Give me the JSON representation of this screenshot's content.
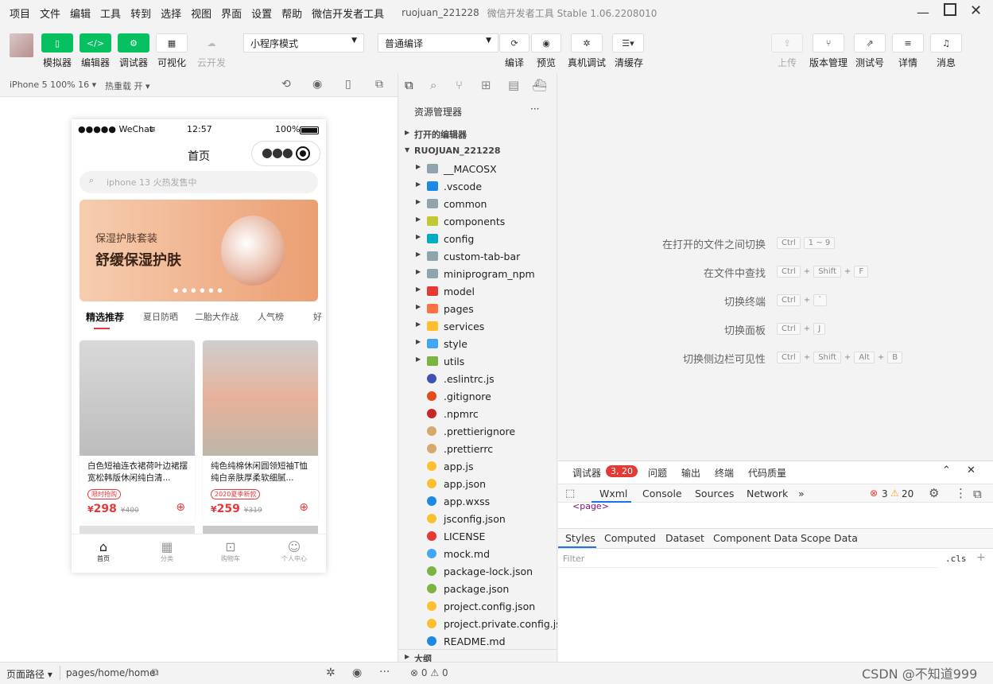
{
  "menubar": {
    "items": [
      "项目",
      "文件",
      "编辑",
      "工具",
      "转到",
      "选择",
      "视图",
      "界面",
      "设置",
      "帮助",
      "微信开发者工具"
    ],
    "project_name": "ruojuan_221228",
    "app_title": "微信开发者工具 Stable 1.06.2208010"
  },
  "toolbar": {
    "simulator": "模拟器",
    "editor": "编辑器",
    "debugger": "调试器",
    "visual": "可视化",
    "cloud": "云开发",
    "mode_select": "小程序模式",
    "compile_select": "普通编译",
    "compile": "编译",
    "preview": "预览",
    "remote_debug": "真机调试",
    "clear_cache": "清缓存",
    "upload": "上传",
    "version": "版本管理",
    "test_id": "测试号",
    "details": "详情",
    "messages": "消息"
  },
  "simbar": {
    "device": "iPhone 5 100% 16",
    "hot_reload": "热重载 开"
  },
  "phone": {
    "status_left": "●●●●● WeChat",
    "time": "12:57",
    "battery": "100%",
    "nav_title": "首页",
    "search_placeholder": "iphone 13 火热发售中",
    "banner_sub": "保湿护肤套装",
    "banner_title": "舒缓保湿护肤",
    "tabs": [
      "精选推荐",
      "夏日防晒",
      "二胎大作战",
      "人气榜",
      "好"
    ],
    "products": [
      {
        "title": "白色短袖连衣裙荷叶边裙摆宽松韩版休闲纯白清...",
        "tag": "限时抢购",
        "price": "298",
        "old": "400",
        "color": "#c9c9c9"
      },
      {
        "title": "纯色纯棉休闲圆领短袖T恤纯白亲肤厚柔软细腻...",
        "tag": "2020夏季新款",
        "price": "259",
        "old": "319",
        "color": "#d5a890"
      }
    ],
    "currency": "¥",
    "tabbar": [
      {
        "label": "首页",
        "icon": "⌂"
      },
      {
        "label": "分类",
        "icon": "▦"
      },
      {
        "label": "购物车",
        "icon": "⊡"
      },
      {
        "label": "个人中心",
        "icon": "☺"
      }
    ]
  },
  "explorer": {
    "title": "资源管理器",
    "more": "···",
    "open_editors": "打开的编辑器",
    "root": "RUOJUAN_221228",
    "outline": "大纲",
    "folders": [
      {
        "name": "__MACOSX",
        "color": "#90a4ae"
      },
      {
        "name": ".vscode",
        "color": "#1e88e5"
      },
      {
        "name": "common",
        "color": "#90a4ae"
      },
      {
        "name": "components",
        "color": "#c0ca33"
      },
      {
        "name": "config",
        "color": "#00acc1"
      },
      {
        "name": "custom-tab-bar",
        "color": "#90a4ae"
      },
      {
        "name": "miniprogram_npm",
        "color": "#90a4ae"
      },
      {
        "name": "model",
        "color": "#e53935"
      },
      {
        "name": "pages",
        "color": "#ff7043"
      },
      {
        "name": "services",
        "color": "#fbc02d"
      },
      {
        "name": "style",
        "color": "#42a5f5"
      },
      {
        "name": "utils",
        "color": "#7cb342"
      }
    ],
    "files": [
      {
        "name": ".eslintrc.js",
        "color": "#3f51b5"
      },
      {
        "name": ".gitignore",
        "color": "#e64a19"
      },
      {
        "name": ".npmrc",
        "color": "#c62828"
      },
      {
        "name": ".prettierignore",
        "color": "#d7a86e"
      },
      {
        "name": ".prettierrc",
        "color": "#d7a86e"
      },
      {
        "name": "app.js",
        "color": "#fbc02d"
      },
      {
        "name": "app.json",
        "color": "#fbc02d"
      },
      {
        "name": "app.wxss",
        "color": "#1e88e5"
      },
      {
        "name": "jsconfig.json",
        "color": "#fbc02d"
      },
      {
        "name": "LICENSE",
        "color": "#e53935"
      },
      {
        "name": "mock.md",
        "color": "#42a5f5"
      },
      {
        "name": "package-lock.json",
        "color": "#7cb342"
      },
      {
        "name": "package.json",
        "color": "#7cb342"
      },
      {
        "name": "project.config.json",
        "color": "#fbc02d"
      },
      {
        "name": "project.private.config.js...",
        "color": "#fbc02d"
      },
      {
        "name": "README.md",
        "color": "#1e88e5"
      }
    ]
  },
  "editor": {
    "shortcuts": [
      {
        "label": "在打开的文件之间切换",
        "keys": [
          "Ctrl",
          "1 ~ 9"
        ]
      },
      {
        "label": "在文件中查找",
        "keys": [
          "Ctrl",
          "+",
          "Shift",
          "+",
          "F"
        ]
      },
      {
        "label": "切换终端",
        "keys": [
          "Ctrl",
          "+",
          "`"
        ]
      },
      {
        "label": "切换面板",
        "keys": [
          "Ctrl",
          "+",
          "J"
        ]
      },
      {
        "label": "切换侧边栏可见性",
        "keys": [
          "Ctrl",
          "+",
          "Shift",
          "+",
          "Alt",
          "+",
          "B"
        ]
      }
    ]
  },
  "debug": {
    "tabs": [
      "调试器",
      "问题",
      "输出",
      "终端",
      "代码质量"
    ],
    "badge": "3, 20",
    "devtools_tabs": [
      "Wxml",
      "Console",
      "Sources",
      "Network"
    ],
    "errors": "3",
    "warnings": "20",
    "wxml_line": "<page>",
    "style_tabs": [
      "Styles",
      "Computed",
      "Dataset",
      "Component Data",
      "Scope Data"
    ],
    "filter_placeholder": "Filter",
    "cls": ".cls"
  },
  "bottombar": {
    "page_path_label": "页面路径",
    "page_path": "pages/home/home",
    "errs": "0",
    "warns": "0",
    "watermark": "CSDN @不知道999"
  }
}
